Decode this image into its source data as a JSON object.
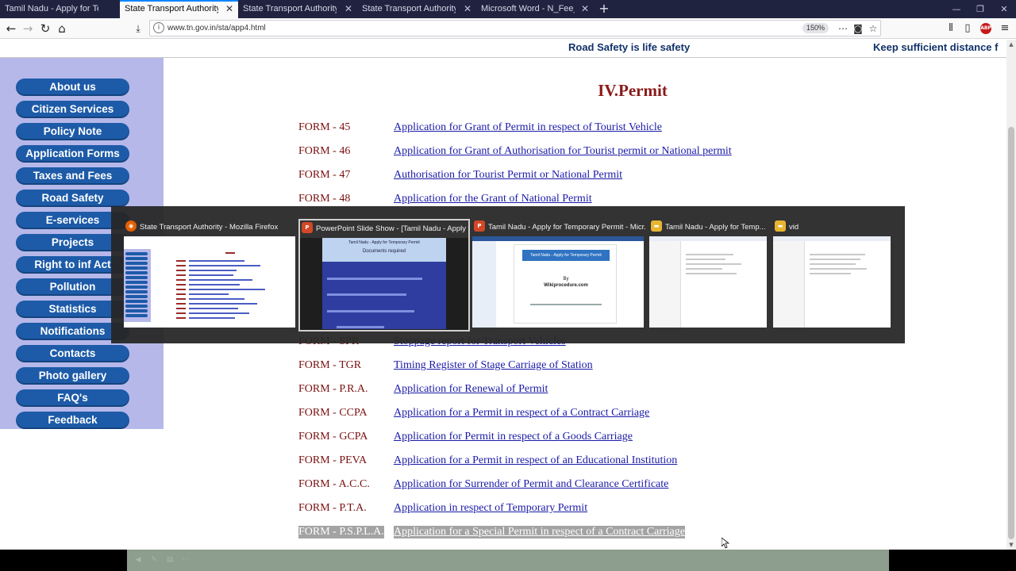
{
  "browser": {
    "tabs": [
      {
        "title": "Tamil Nadu - Apply for Temporary",
        "active": false
      },
      {
        "title": "State Transport Authority",
        "active": true
      },
      {
        "title": "State Transport Authority",
        "active": false
      },
      {
        "title": "State Transport Authority",
        "active": false
      },
      {
        "title": "Microsoft Word - N_Fee_Struc - N",
        "active": false
      }
    ],
    "new_tab_symbol": "+",
    "url": "www.tn.gov.in/sta/app4.html",
    "zoom": "150%",
    "page_actions_symbol": "⋯",
    "abp_label": "ABP"
  },
  "page": {
    "marquee": [
      "Road Safety is life safety",
      "Keep sufficient distance f"
    ],
    "sidebar": [
      "About us",
      "Citizen Services",
      "Policy Note",
      "Application Forms",
      "Taxes and Fees",
      "Road Safety",
      "E-services",
      "Projects",
      "Right to inf Act",
      "Pollution",
      "Statistics",
      "Notifications",
      "Contacts",
      "Photo gallery",
      "FAQ's",
      "Feedback"
    ],
    "heading": "IV.Permit",
    "forms": [
      {
        "code": "FORM - 45",
        "title": "Application for Grant of Permit in respect of Tourist Vehicle"
      },
      {
        "code": "FORM - 46",
        "title": "Application for Grant of Authorisation for Tourist permit or National permit"
      },
      {
        "code": "FORM - 47",
        "title": "Authorisation for Tourist Permit or National Permit"
      },
      {
        "code": "FORM - 48",
        "title": "Application for the Grant of National Permit"
      },
      {
        "code": "FORM - SPR",
        "title": "Stoppage report for Transport Vehicles"
      },
      {
        "code": "FORM - TGR",
        "title": "Timing Register of Stage Carriage of Station"
      },
      {
        "code": "FORM - P.R.A.",
        "title": "Application for Renewal of Permit"
      },
      {
        "code": "FORM - CCPA",
        "title": "Application for a Permit in respect of a Contract Carriage"
      },
      {
        "code": "FORM - GCPA",
        "title": "Application for Permit in respect of a Goods Carriage"
      },
      {
        "code": "FORM - PEVA",
        "title": "Application for a Permit in respect of an Educational Institution"
      },
      {
        "code": "FORM - A.C.C.",
        "title": "Application for Surrender of Permit and Clearance Certificate"
      },
      {
        "code": "FORM - P.T.A.",
        "title": "Application in respect of Temporary Permit"
      },
      {
        "code": "FORM - P.S.P.L.A.",
        "title": "Application for a Special Permit in respect of a Contract Carriage"
      }
    ],
    "selected_form_index": 12
  },
  "switcher": {
    "items": [
      {
        "title": "State Transport Authority - Mozilla Firefox",
        "icon": "firefox-icon",
        "active": false
      },
      {
        "title": "PowerPoint Slide Show - [Tamil Nadu - Apply f...",
        "icon": "powerpoint-icon",
        "active": true
      },
      {
        "title": "Tamil Nadu - Apply for Temporary Permit - Micr...",
        "icon": "powerpoint-icon",
        "active": false
      },
      {
        "title": "Tamil Nadu - Apply for Temp...",
        "icon": "folder-icon",
        "active": false
      },
      {
        "title": "vid",
        "icon": "folder-icon",
        "active": false
      }
    ],
    "slide_preview": {
      "heading": "Tamil Nadu - Apply for Temporary Permit",
      "subheading": "Documents required"
    },
    "word_preview": {
      "banner": "Tamil Nadu - Apply for Temporary Permit",
      "by": "By",
      "site": "Wikiprocedure.com"
    }
  },
  "colors": {
    "sidebar_bg": "#b6b8ea",
    "sidebar_button": "#1d5ba8",
    "heading": "#8b1a1a",
    "form_code": "#7a1010",
    "form_link": "#1a1aa8",
    "tabstrip": "#202340"
  }
}
